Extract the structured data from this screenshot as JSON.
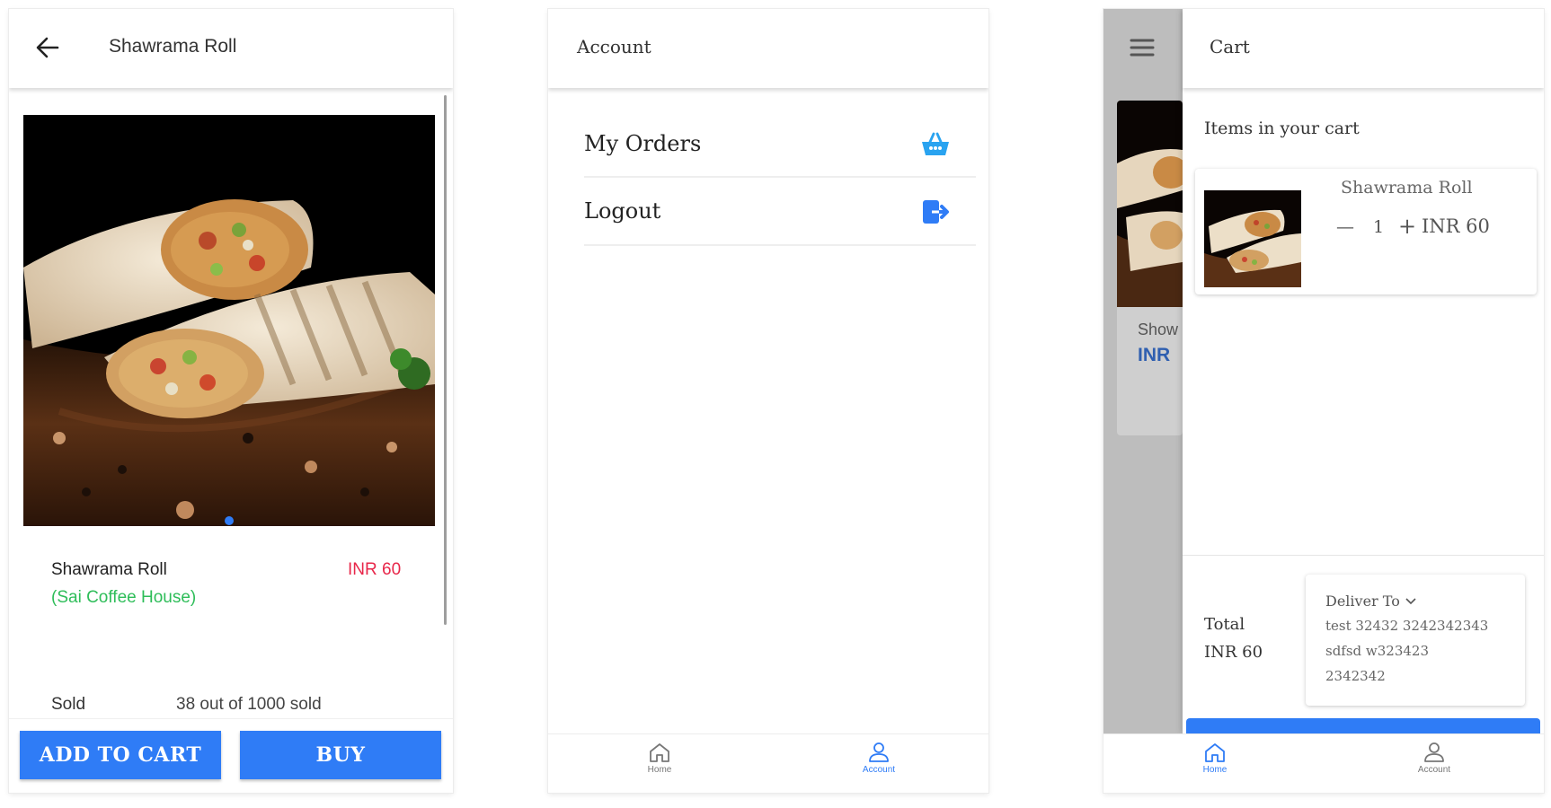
{
  "product_screen": {
    "title": "Shawrama Roll",
    "product_name": "Shawrama Roll",
    "shop": "(Sai Coffee House)",
    "price": "INR 60",
    "sold_label": "Sold",
    "sold_value": "38 out of 1000 sold",
    "add_to_cart": "ADD TO CART",
    "buy": "BUY",
    "image_alt": "shawarma-roll-photo"
  },
  "account_screen": {
    "title": "Account",
    "items": [
      {
        "label": "My Orders",
        "icon": "basket-icon"
      },
      {
        "label": "Logout",
        "icon": "logout-icon"
      }
    ],
    "nav": [
      {
        "label": "Home",
        "active": false
      },
      {
        "label": "Account",
        "active": true
      }
    ]
  },
  "cart_screen": {
    "title": "Cart",
    "heading": "Items in your cart",
    "item": {
      "name": "Shawrama Roll",
      "minus": "—",
      "qty": "1",
      "plus": "+",
      "price": "INR 60"
    },
    "total_label": "Total",
    "total_value": "INR 60",
    "deliver_to": "Deliver To",
    "address_lines": [
      "test 32432 3242342343",
      "sdfsd w323423",
      "2342342"
    ],
    "behind_peek": {
      "name": "Show",
      "price": "INR"
    },
    "nav": [
      {
        "label": "Home",
        "active": true
      },
      {
        "label": "Account",
        "active": false
      }
    ]
  },
  "colors": {
    "accent": "#2f7cf6",
    "price_red": "#e8274a",
    "shop_green": "#2ebd59",
    "basket_blue": "#29a3f0",
    "nav_inactive": "#777777"
  }
}
